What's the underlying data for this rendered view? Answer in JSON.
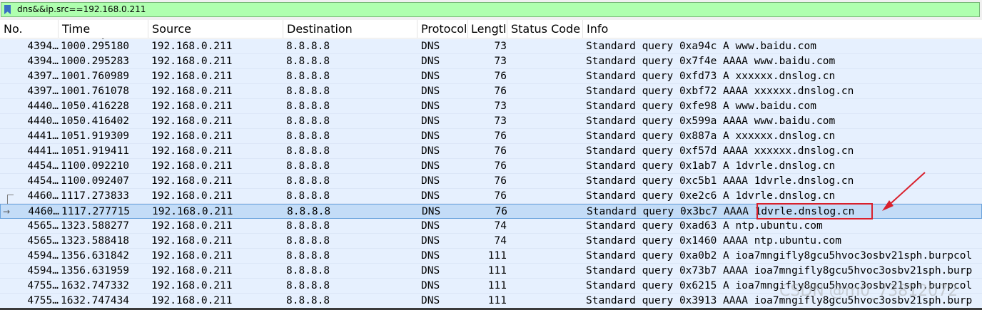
{
  "filter": {
    "text": "dns&&ip.src==192.168.0.211"
  },
  "columns": {
    "no": "No.",
    "time": "Time",
    "source": "Source",
    "destination": "Destination",
    "protocol": "Protocol",
    "length": "Lengtl",
    "status_code": "Status Code",
    "info": "Info"
  },
  "rows": [
    {
      "no": "4394…",
      "time": "1000.295180",
      "src": "192.168.0.211",
      "dst": "8.8.8.8",
      "proto": "DNS",
      "len": "73",
      "status": "",
      "info": "Standard query 0xa94c A www.baidu.com"
    },
    {
      "no": "4394…",
      "time": "1000.295283",
      "src": "192.168.0.211",
      "dst": "8.8.8.8",
      "proto": "DNS",
      "len": "73",
      "status": "",
      "info": "Standard query 0x7f4e AAAA www.baidu.com"
    },
    {
      "no": "4397…",
      "time": "1001.760989",
      "src": "192.168.0.211",
      "dst": "8.8.8.8",
      "proto": "DNS",
      "len": "76",
      "status": "",
      "info": "Standard query 0xfd73 A xxxxxx.dnslog.cn"
    },
    {
      "no": "4397…",
      "time": "1001.761078",
      "src": "192.168.0.211",
      "dst": "8.8.8.8",
      "proto": "DNS",
      "len": "76",
      "status": "",
      "info": "Standard query 0xbf72 AAAA xxxxxx.dnslog.cn"
    },
    {
      "no": "4440…",
      "time": "1050.416228",
      "src": "192.168.0.211",
      "dst": "8.8.8.8",
      "proto": "DNS",
      "len": "73",
      "status": "",
      "info": "Standard query 0xfe98 A www.baidu.com"
    },
    {
      "no": "4440…",
      "time": "1050.416402",
      "src": "192.168.0.211",
      "dst": "8.8.8.8",
      "proto": "DNS",
      "len": "73",
      "status": "",
      "info": "Standard query 0x599a AAAA www.baidu.com"
    },
    {
      "no": "4441…",
      "time": "1051.919309",
      "src": "192.168.0.211",
      "dst": "8.8.8.8",
      "proto": "DNS",
      "len": "76",
      "status": "",
      "info": "Standard query 0x887a A xxxxxx.dnslog.cn"
    },
    {
      "no": "4441…",
      "time": "1051.919411",
      "src": "192.168.0.211",
      "dst": "8.8.8.8",
      "proto": "DNS",
      "len": "76",
      "status": "",
      "info": "Standard query 0xf57d AAAA xxxxxx.dnslog.cn"
    },
    {
      "no": "4454…",
      "time": "1100.092210",
      "src": "192.168.0.211",
      "dst": "8.8.8.8",
      "proto": "DNS",
      "len": "76",
      "status": "",
      "info": "Standard query 0x1ab7 A 1dvrle.dnslog.cn"
    },
    {
      "no": "4454…",
      "time": "1100.092407",
      "src": "192.168.0.211",
      "dst": "8.8.8.8",
      "proto": "DNS",
      "len": "76",
      "status": "",
      "info": "Standard query 0xc5b1 AAAA 1dvrle.dnslog.cn"
    },
    {
      "no": "4460…",
      "time": "1117.273833",
      "src": "192.168.0.211",
      "dst": "8.8.8.8",
      "proto": "DNS",
      "len": "76",
      "status": "",
      "info": "Standard query 0xe2c6 A 1dvrle.dnslog.cn"
    },
    {
      "no": "4460…",
      "time": "1117.277715",
      "src": "192.168.0.211",
      "dst": "8.8.8.8",
      "proto": "DNS",
      "len": "76",
      "status": "",
      "info": "Standard query 0x3bc7 AAAA 1dvrle.dnslog.cn",
      "selected": true
    },
    {
      "no": "4565…",
      "time": "1323.588277",
      "src": "192.168.0.211",
      "dst": "8.8.8.8",
      "proto": "DNS",
      "len": "74",
      "status": "",
      "info": "Standard query 0xad63 A ntp.ubuntu.com"
    },
    {
      "no": "4565…",
      "time": "1323.588418",
      "src": "192.168.0.211",
      "dst": "8.8.8.8",
      "proto": "DNS",
      "len": "74",
      "status": "",
      "info": "Standard query 0x1460 AAAA ntp.ubuntu.com"
    },
    {
      "no": "4594…",
      "time": "1356.631842",
      "src": "192.168.0.211",
      "dst": "8.8.8.8",
      "proto": "DNS",
      "len": "111",
      "status": "",
      "info": "Standard query 0xa0b2 A ioa7mngifly8gcu5hvoc3osbv21sph.burpcol"
    },
    {
      "no": "4594…",
      "time": "1356.631959",
      "src": "192.168.0.211",
      "dst": "8.8.8.8",
      "proto": "DNS",
      "len": "111",
      "status": "",
      "info": "Standard query 0x73b7 AAAA ioa7mngifly8gcu5hvoc3osbv21sph.burp"
    },
    {
      "no": "4755…",
      "time": "1632.747332",
      "src": "192.168.0.211",
      "dst": "8.8.8.8",
      "proto": "DNS",
      "len": "111",
      "status": "",
      "info": "Standard query 0x6215 A ioa7mngifly8gcu5hvoc3osbv21sph.burpcol"
    },
    {
      "no": "4755…",
      "time": "1632.747434",
      "src": "192.168.0.211",
      "dst": "8.8.8.8",
      "proto": "DNS",
      "len": "111",
      "status": "",
      "info": "Standard query 0x3913 AAAA ioa7mngifly8gcu5hvoc3osbv21sph.burp"
    }
  ],
  "watermark": "CSDN @m0_73812072",
  "colors": {
    "filter_bg": "#afffaf",
    "row_bg": "#e6f0fe",
    "selected_bg": "#c3dcf7",
    "annotation": "#d9202c"
  }
}
